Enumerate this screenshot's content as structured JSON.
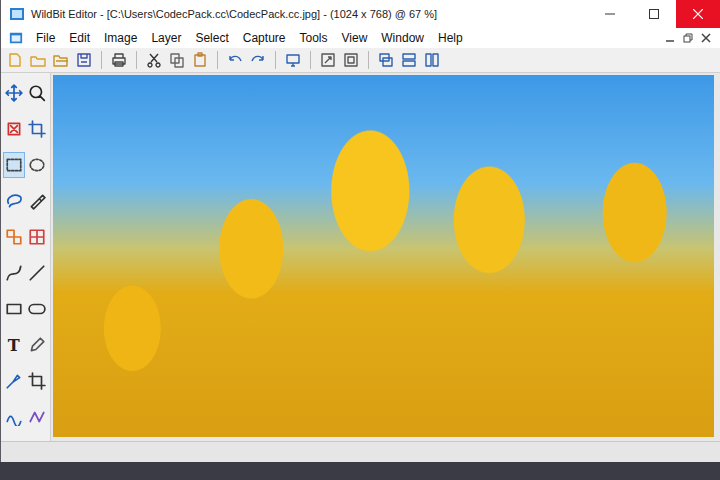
{
  "window": {
    "title": "WildBit Editor - [C:\\Users\\CodecPack.cc\\CodecPack.cc.jpg] - (1024 x 768) @ 67 %]"
  },
  "menu": {
    "items": [
      "File",
      "Edit",
      "Image",
      "Layer",
      "Select",
      "Capture",
      "Tools",
      "View",
      "Window",
      "Help"
    ]
  },
  "tools": [
    {
      "kind": "icon",
      "selected": false
    },
    {
      "kind": "icon",
      "selected": false
    },
    {
      "kind": "icon",
      "selected": false
    },
    {
      "kind": "icon",
      "selected": false
    },
    {
      "kind": "icon",
      "selected": true
    },
    {
      "kind": "icon",
      "selected": false
    },
    {
      "kind": "icon",
      "selected": false
    },
    {
      "kind": "icon",
      "selected": false
    },
    {
      "kind": "icon",
      "selected": false
    },
    {
      "kind": "icon",
      "selected": false
    },
    {
      "kind": "icon",
      "selected": false
    },
    {
      "kind": "icon",
      "selected": false
    },
    {
      "kind": "icon",
      "selected": false
    },
    {
      "kind": "icon",
      "selected": false
    },
    {
      "kind": "glyph",
      "label": "T",
      "selected": false
    },
    {
      "kind": "icon",
      "selected": false
    },
    {
      "kind": "icon",
      "selected": false
    },
    {
      "kind": "icon",
      "selected": false
    },
    {
      "kind": "icon",
      "selected": false
    },
    {
      "kind": "icon",
      "selected": false
    }
  ]
}
